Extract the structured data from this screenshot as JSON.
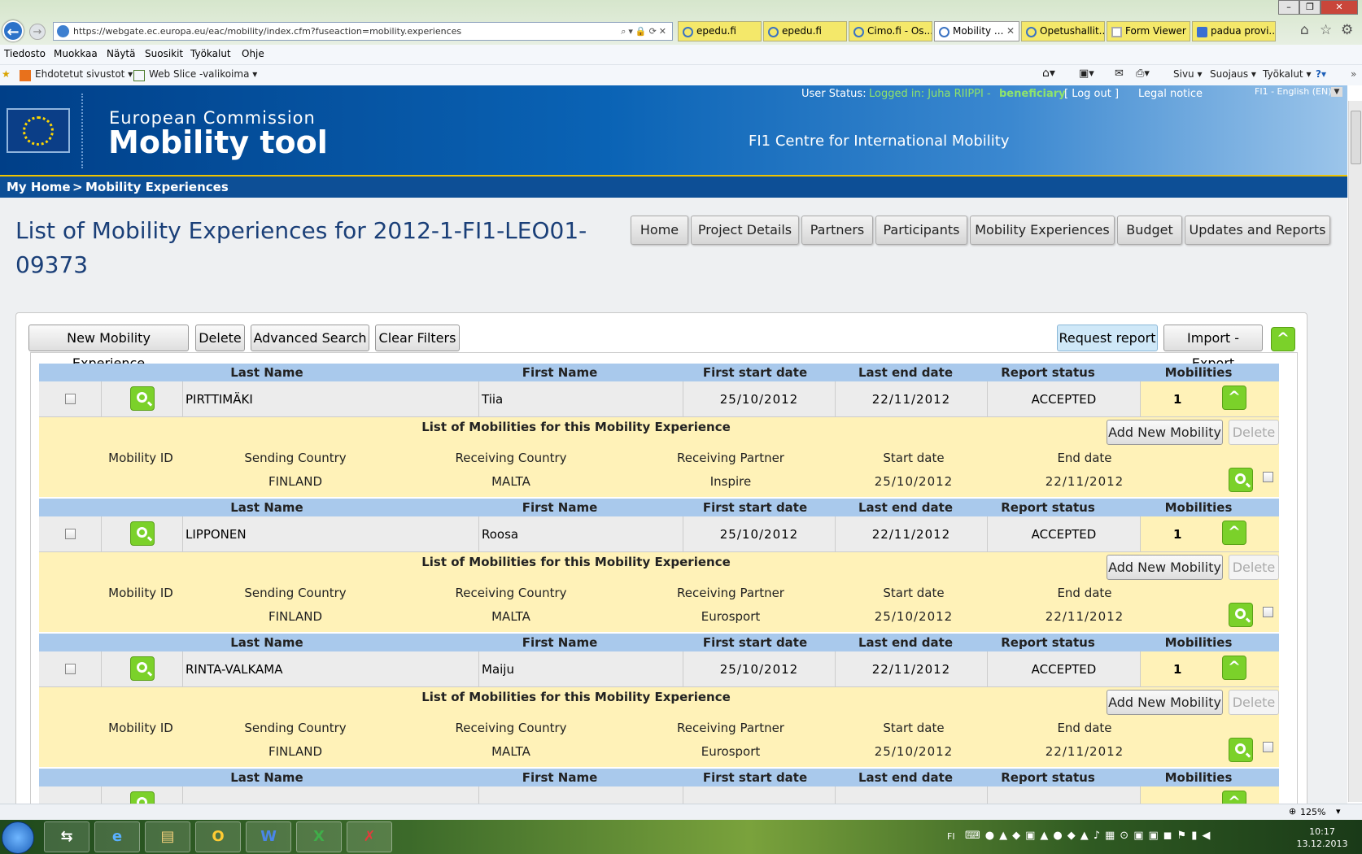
{
  "browser": {
    "url": "https://webgate.ec.europa.eu/eac/mobility/index.cfm?fuseaction=mobility.experiences",
    "tabs": [
      {
        "label": "epedu.fi"
      },
      {
        "label": "epedu.fi"
      },
      {
        "label": "Cimo.fi - Os..."
      },
      {
        "label": "Mobility ..."
      },
      {
        "label": "Opetushallit..."
      },
      {
        "label": "Form Viewer"
      },
      {
        "label": "padua provi..."
      }
    ],
    "menu": [
      "Tiedosto",
      "Muokkaa",
      "Näytä",
      "Suosikit",
      "Työkalut",
      "Ohje"
    ],
    "favorites": [
      "Ehdotetut sivustot ▾",
      "Web Slice -valikoima ▾"
    ],
    "commandbar": [
      "Sivu ▾",
      "Suojaus ▾",
      "Työkalut ▾"
    ],
    "zoom": "125%"
  },
  "site": {
    "user_status_label": "User Status:",
    "logged_in_text": "Logged in: Juha RIIPPI -",
    "role": "beneficiary",
    "logout": "[  Log out  ]",
    "legal_notice": "Legal notice",
    "language": "FI1 - English (EN)",
    "brand_small": "European Commission",
    "brand_big": "Mobility tool",
    "centre": "FI1 Centre for International Mobility",
    "breadcrumb_home": "My Home",
    "breadcrumb_sep": ">",
    "breadcrumb_current": "Mobility Experiences"
  },
  "page": {
    "title": "List of Mobility Experiences for 2012-1-FI1-LEO01-09373",
    "nav_tabs": [
      "Home",
      "Project Details",
      "Partners",
      "Participants",
      "Mobility Experiences",
      "Budget",
      "Updates and Reports"
    ],
    "toolbar": {
      "new": "New Mobility Experience",
      "delete": "Delete",
      "advanced_search": "Advanced Search",
      "clear_filters": "Clear Filters",
      "request_report": "Request report",
      "import_export": "Import - Export"
    },
    "columns": [
      "Last Name",
      "First Name",
      "First start date",
      "Last end date",
      "Report status",
      "Mobilities"
    ],
    "sub_title": "List of Mobilities for this Mobility Experience",
    "sub_columns": [
      "Mobility ID",
      "Sending Country",
      "Receiving Country",
      "Receiving Partner",
      "Start date",
      "End date"
    ],
    "add_mobility": "Add New Mobility",
    "sub_delete": "Delete",
    "experiences": [
      {
        "last_name": "PIRTTIMÄKI",
        "first_name": "Tiia",
        "first_start": "25/10/2012",
        "last_end": "22/11/2012",
        "status": "ACCEPTED",
        "mobilities": "1",
        "mobility": {
          "id": "",
          "sending": "FINLAND",
          "receiving": "MALTA",
          "partner": "Inspire",
          "start": "25/10/2012",
          "end": "22/11/2012"
        }
      },
      {
        "last_name": "LIPPONEN",
        "first_name": "Roosa",
        "first_start": "25/10/2012",
        "last_end": "22/11/2012",
        "status": "ACCEPTED",
        "mobilities": "1",
        "mobility": {
          "id": "",
          "sending": "FINLAND",
          "receiving": "MALTA",
          "partner": "Eurosport",
          "start": "25/10/2012",
          "end": "22/11/2012"
        }
      },
      {
        "last_name": "RINTA-VALKAMA",
        "first_name": "Maiju",
        "first_start": "25/10/2012",
        "last_end": "22/11/2012",
        "status": "ACCEPTED",
        "mobilities": "1",
        "mobility": {
          "id": "",
          "sending": "FINLAND",
          "receiving": "MALTA",
          "partner": "Eurosport",
          "start": "25/10/2012",
          "end": "22/11/2012"
        }
      }
    ]
  },
  "taskbar": {
    "lang": "FI",
    "time": "10:17",
    "date": "13.12.2013"
  }
}
